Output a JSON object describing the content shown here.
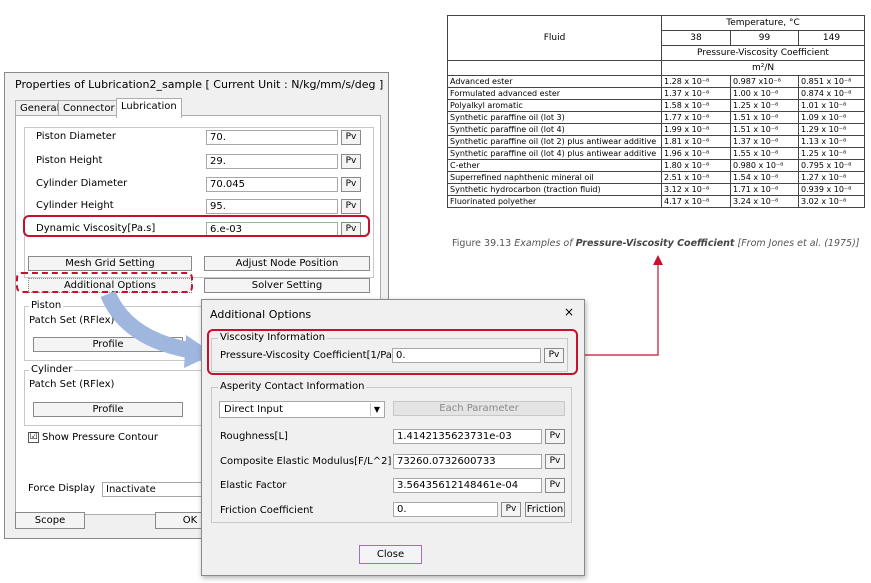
{
  "colors": {
    "highlight": "#c8102e",
    "arrow": "#9fb7df"
  },
  "props_dialog": {
    "title": "Properties of Lubrication2_sample [ Current Unit : N/kg/mm/s/deg ]",
    "tabs": [
      "General",
      "Connector",
      "Lubrication"
    ],
    "fields": [
      {
        "label": "Piston Diameter",
        "value": "70."
      },
      {
        "label": "Piston Height",
        "value": "29."
      },
      {
        "label": "Cylinder Diameter",
        "value": "70.045"
      },
      {
        "label": "Cylinder Height",
        "value": "95."
      },
      {
        "label": "Dynamic Viscosity[Pa.s]",
        "value": "6.e-03"
      }
    ],
    "pv_label": "Pv",
    "buttons": {
      "mesh_grid": "Mesh Grid Setting",
      "adjust_node": "Adjust Node Position",
      "additional": "Additional Options",
      "solver": "Solver Setting",
      "scope": "Scope",
      "ok": "OK"
    },
    "piston": {
      "legend": "Piston",
      "patch_label": "Patch Set (RFlex)",
      "profile": "Profile"
    },
    "cylinder": {
      "legend": "Cylinder",
      "patch_label": "Patch Set (RFlex)",
      "profile": "Profile"
    },
    "show_pressure": {
      "label": "Show Pressure Contour",
      "checked": true,
      "mark": "☑"
    },
    "force_display": {
      "label": "Force Display",
      "value": "Inactivate"
    }
  },
  "addl_dialog": {
    "title": "Additional Options",
    "close_glyph": "×",
    "viscosity": {
      "legend": "Viscosity Information",
      "label": "Pressure-Viscosity Coefficient[1/Pa]",
      "value": "0."
    },
    "asperity": {
      "legend": "Asperity Contact Information",
      "mode": "Direct Input",
      "each_parameter": "Each Parameter",
      "roughness": {
        "label": "Roughness[L]",
        "value": "1.4142135623731e-03"
      },
      "modulus": {
        "label": "Composite Elastic Modulus[F/L^2]",
        "value": "73260.0732600733"
      },
      "elastic": {
        "label": "Elastic Factor",
        "value": "3.56435612148461e-04"
      },
      "friction": {
        "label": "Friction Coefficient",
        "value": "0.",
        "friction_btn": "Friction"
      }
    },
    "pv_label": "Pv",
    "close_label": "Close"
  },
  "ref_table": {
    "fluid_header": "Fluid",
    "temp_header": "Temperature, °C",
    "temps": [
      "38",
      "99",
      "149"
    ],
    "coef_header": "Pressure-Viscosity Coefficient",
    "unit_header": "m²/N",
    "rows": [
      {
        "fluid": "Advanced ester",
        "v": [
          "1.28 x 10⁻⁸",
          "0.987 x10⁻⁸",
          "0.851 x 10⁻⁸"
        ]
      },
      {
        "fluid": "Formulated advanced ester",
        "v": [
          "1.37 x 10⁻⁸",
          "1.00 x 10⁻⁸",
          "0.874 x 10⁻⁸"
        ]
      },
      {
        "fluid": "Polyalkyl aromatic",
        "v": [
          "1.58 x 10⁻⁸",
          "1.25 x 10⁻⁸",
          "1.01 x 10⁻⁸"
        ]
      },
      {
        "fluid": "Synthetic paraffine oil (lot 3)",
        "v": [
          "1.77 x 10⁻⁸",
          "1.51 x 10⁻⁸",
          "1.09 x 10⁻⁸"
        ]
      },
      {
        "fluid": "Synthetic paraffine oil (lot 4)",
        "v": [
          "1.99 x 10⁻⁸",
          "1.51 x 10⁻⁸",
          "1.29 x 10⁻⁸"
        ]
      },
      {
        "fluid": "Synthetic paraffine oil (lot 2) plus antiwear additive",
        "v": [
          "1.81 x 10⁻⁸",
          "1.37 x 10⁻⁸",
          "1.13 x 10⁻⁸"
        ]
      },
      {
        "fluid": "Synthetic paraffine oil (lot 4) plus antiwear additive",
        "v": [
          "1.96 x 10⁻⁸",
          "1.55 x 10⁻⁸",
          "1.25 x 10⁻⁸"
        ]
      },
      {
        "fluid": "C-ether",
        "v": [
          "1.80 x 10⁻⁸",
          "0.980 x 10⁻⁸",
          "0.795 x 10⁻⁸"
        ]
      },
      {
        "fluid": "Superrefined naphthenic mineral oil",
        "v": [
          "2.51 x 10⁻⁸",
          "1.54 x 10⁻⁸",
          "1.27 x 10⁻⁸"
        ]
      },
      {
        "fluid": "Synthetic hydrocarbon (traction fluid)",
        "v": [
          "3.12 x 10⁻⁸",
          "1.71 x 10⁻⁸",
          "0.939 x 10⁻⁸"
        ]
      },
      {
        "fluid": "Fluorinated polyether",
        "v": [
          "4.17 x 10⁻⁸",
          "3.24 x 10⁻⁸",
          "3.02 x 10⁻⁸"
        ]
      }
    ],
    "caption": {
      "prefix": "Figure 39.13 ",
      "italic_a": "Examples of ",
      "bold": "Pressure-Viscosity Coefficient",
      "italic_b": " [From Jones et al. (1975)]"
    }
  }
}
